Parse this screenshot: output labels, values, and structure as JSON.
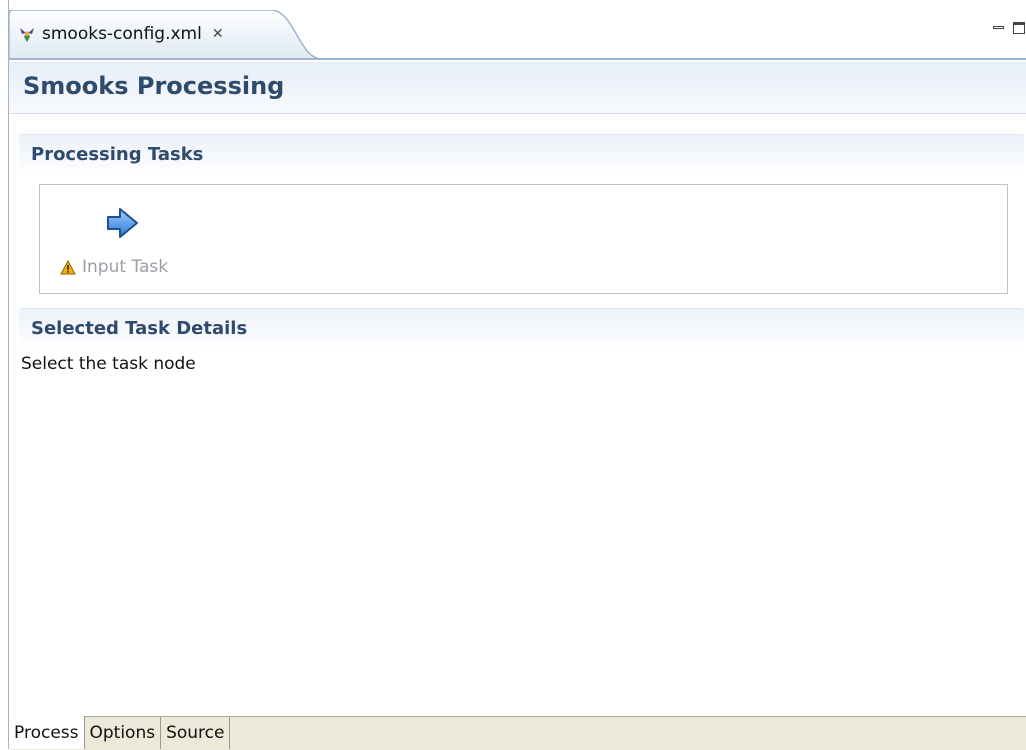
{
  "editor_tab": {
    "icon": "smooks-config-icon",
    "label": "smooks-config.xml",
    "close_glyph": "✕"
  },
  "form": {
    "title": "Smooks Processing"
  },
  "sections": {
    "processing_tasks": {
      "title": "Processing Tasks",
      "task": {
        "icon": "right-arrow-icon",
        "status_icon": "warning-icon",
        "label": "Input Task"
      }
    },
    "selected_task_details": {
      "title": "Selected Task Details",
      "message": "Select the task node"
    }
  },
  "bottom_tabs": [
    {
      "label": "Process",
      "active": true
    },
    {
      "label": "Options",
      "active": false
    },
    {
      "label": "Source",
      "active": false
    }
  ],
  "colors": {
    "title_blue": "#2e4a6d",
    "disabled_text": "#9aa0a6",
    "tab_bar_bg": "#ece9d8"
  }
}
